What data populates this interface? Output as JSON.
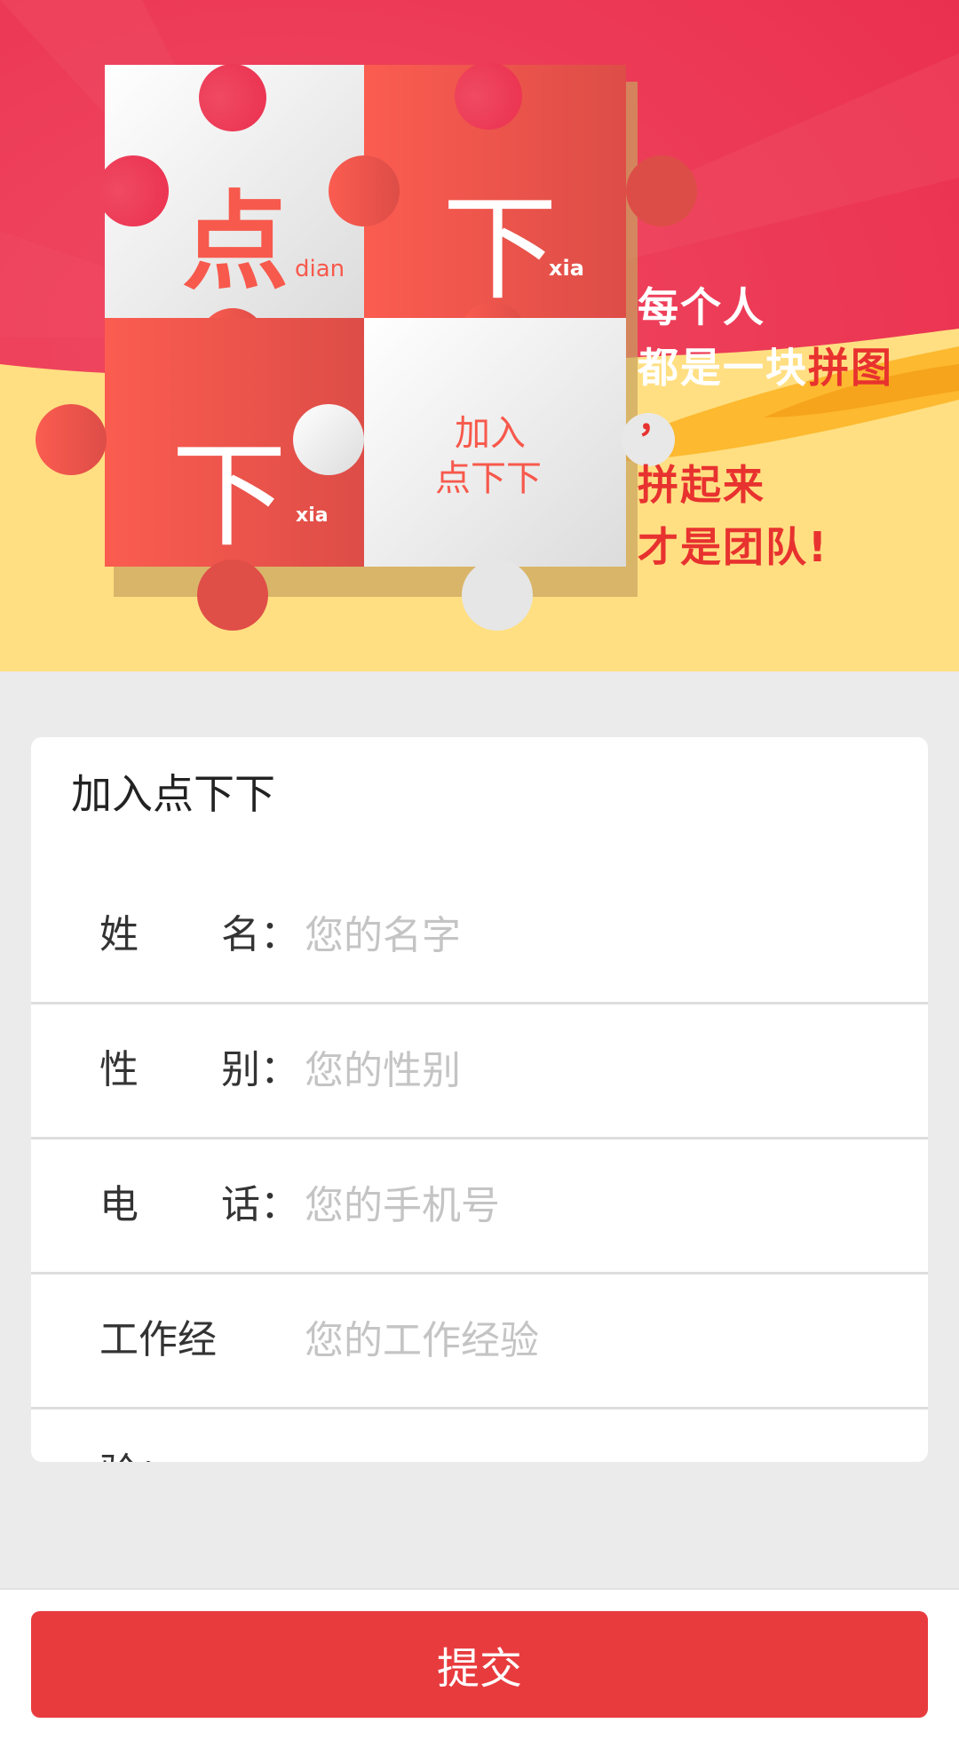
{
  "banner": {
    "tiles": {
      "t1_char": "点",
      "t1_pinyin": "dian",
      "t2_char": "下",
      "t2_pinyin": "xia",
      "t3_char": "下",
      "t3_pinyin": "xia",
      "t4_line1": "加入",
      "t4_line2": "点下下"
    },
    "slogan": {
      "line1": "每个人",
      "line2_a": "都是一块",
      "line2_b": "拼图",
      "comma": "，",
      "line3": "拼起来",
      "line4": "才是团队!"
    }
  },
  "form": {
    "title": "加入点下下",
    "fields": [
      {
        "label_a": "姓",
        "label_b": "名：",
        "placeholder": "您的名字",
        "value": ""
      },
      {
        "label_a": "性",
        "label_b": "别：",
        "placeholder": "您的性别",
        "value": ""
      },
      {
        "label_a": "电",
        "label_b": "话：",
        "placeholder": "您的手机号",
        "value": ""
      },
      {
        "label": "工作经验：",
        "placeholder": "您的工作经验",
        "value": ""
      }
    ]
  },
  "footer": {
    "submit_label": "提交"
  },
  "colors": {
    "accent": "#e83b3e",
    "banner_red": "#f0385a",
    "banner_yellow": "#ffdf82",
    "tile_red": "#f75a4d",
    "tile_white": "#f2f2f2"
  }
}
